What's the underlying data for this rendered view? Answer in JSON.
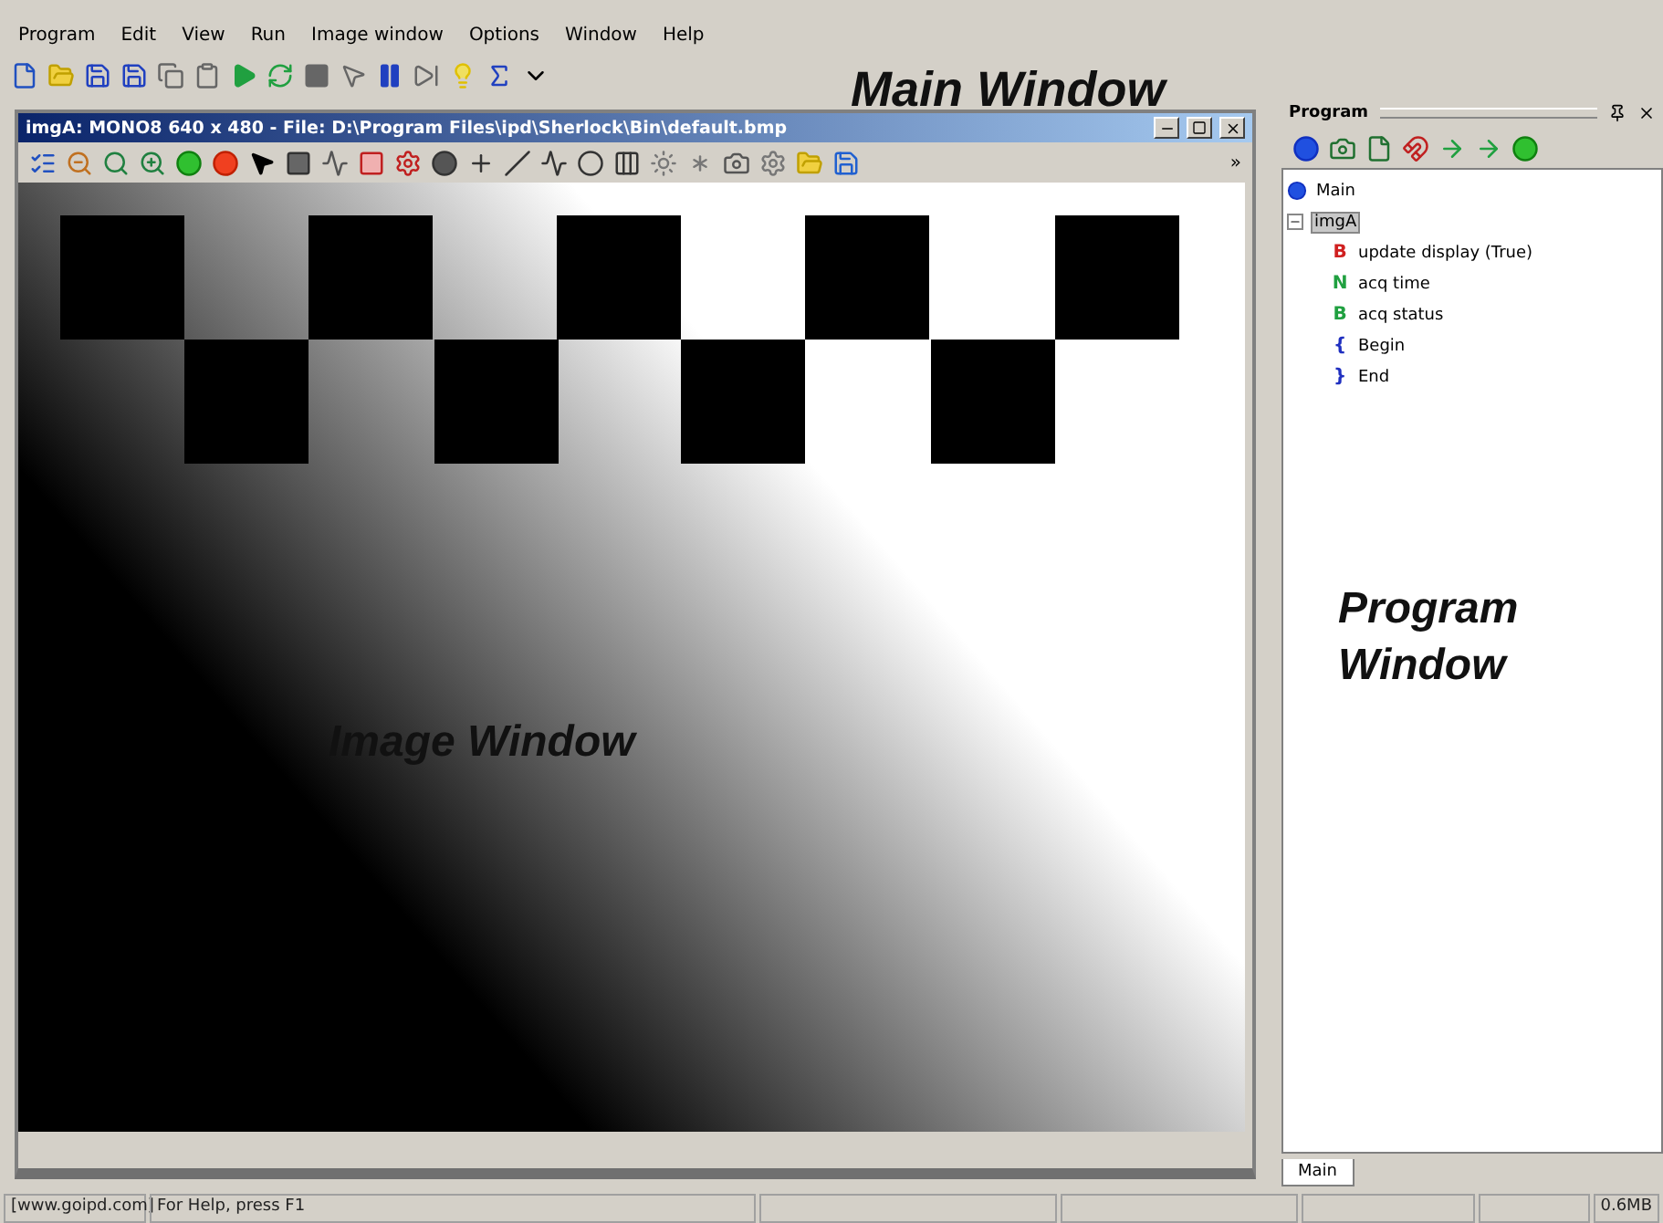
{
  "menu": [
    "Program",
    "Edit",
    "View",
    "Run",
    "Image window",
    "Options",
    "Window",
    "Help"
  ],
  "annotations": [
    {
      "kind": "main",
      "text": "Main Window"
    },
    {
      "text": "Image Window"
    },
    {
      "kind": "program",
      "text": "Program Window"
    }
  ],
  "image_window": {
    "title": "imgA: MONO8 640 x 480 - File: D:\\Program Files\\ipd\\Sherlock\\Bin\\default.bmp",
    "overflow": "»"
  },
  "program_panel": {
    "title": "Program",
    "tab": "Main",
    "tree": [
      {
        "label": "Main",
        "selected": false
      },
      {
        "label": "imgA",
        "selected": true,
        "expanded": true,
        "children": [
          {
            "glyph": "B",
            "label": "update display (True)",
            "color": "#d02020"
          },
          {
            "glyph": "N",
            "label": "acq time",
            "color": "#20a040"
          },
          {
            "glyph": "B",
            "label": "acq status",
            "color": "#20a040"
          },
          {
            "glyph": "{",
            "label": "Begin"
          },
          {
            "glyph": "}",
            "label": "End"
          }
        ]
      }
    ]
  },
  "status_bar": [
    "[www.goipd.com]",
    "For Help, press F1",
    "0.6MB"
  ]
}
